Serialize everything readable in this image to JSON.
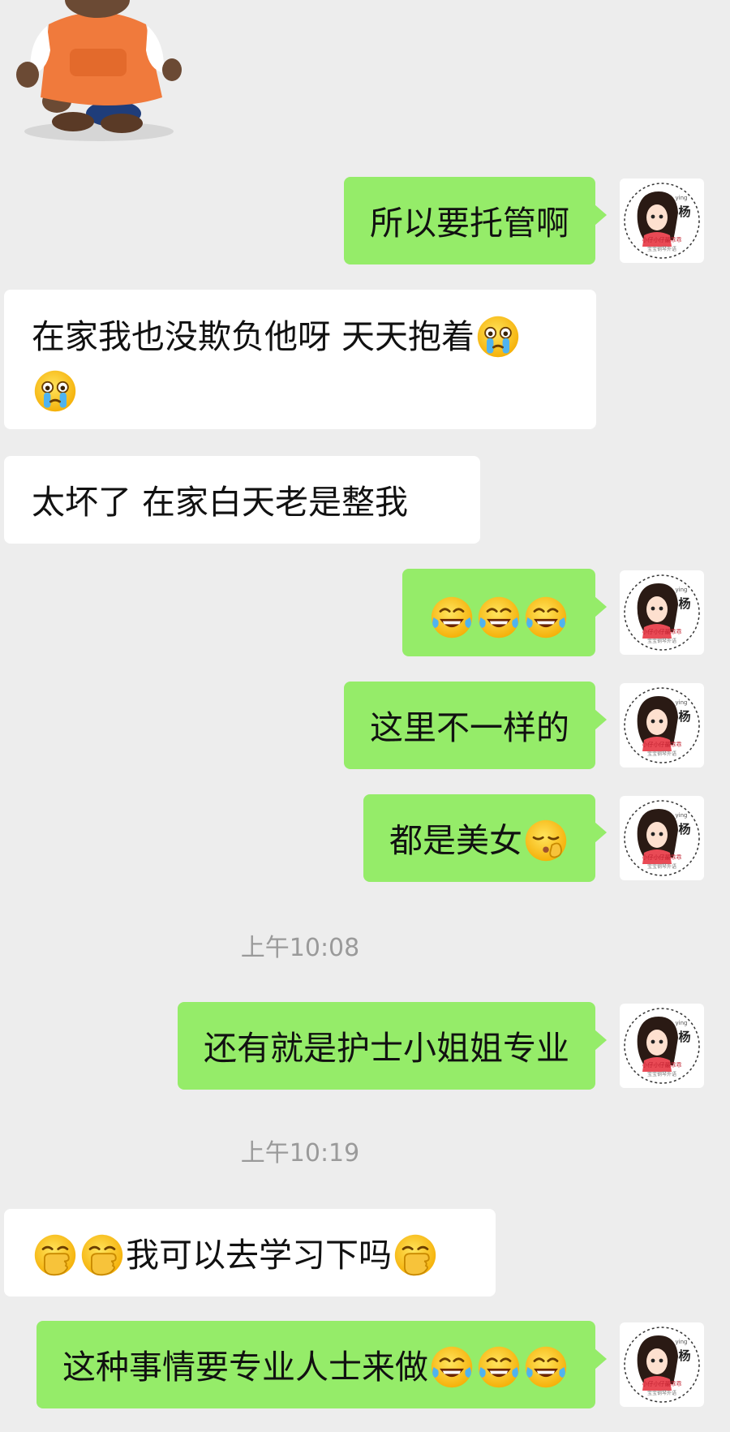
{
  "chat": {
    "timestamps": [
      "上午10:08",
      "上午10:19"
    ],
    "messages": [
      {
        "side": "out",
        "text": "所以要托管啊",
        "emojis": []
      },
      {
        "side": "in",
        "text": "在家我也没欺负他呀 天天抱着",
        "emojis": [
          "crying-face",
          "crying-face"
        ]
      },
      {
        "side": "in",
        "text": "太坏了 在家白天老是整我",
        "emojis": []
      },
      {
        "side": "out",
        "text": "",
        "emojis": [
          "tears-of-joy",
          "tears-of-joy",
          "tears-of-joy"
        ]
      },
      {
        "side": "out",
        "text": "这里不一样的",
        "emojis": []
      },
      {
        "side": "out",
        "text": "都是美女",
        "emojis": [
          "shushing-face"
        ]
      },
      {
        "side": "out",
        "text": "还有就是护士小姐姐专业",
        "emojis": []
      },
      {
        "side": "in",
        "text": "我可以去学习下吗",
        "emojis": [
          "hand-over-mouth",
          "hand-over-mouth",
          "hand-over-mouth"
        ]
      },
      {
        "side": "out",
        "text": "这种事情要专业人士来做",
        "emojis": [
          "tears-of-joy",
          "tears-of-joy",
          "tears-of-joy"
        ]
      }
    ]
  },
  "avatar": {
    "name_char": "杨",
    "small_text": "ying",
    "caption": "小仔小仔最乖乖",
    "subcaption": "宝宝钢琴外语"
  },
  "colors": {
    "background": "#ededed",
    "outgoing_bubble": "#95ec69",
    "incoming_bubble": "#ffffff",
    "timestamp_text": "#9a9a9a"
  }
}
